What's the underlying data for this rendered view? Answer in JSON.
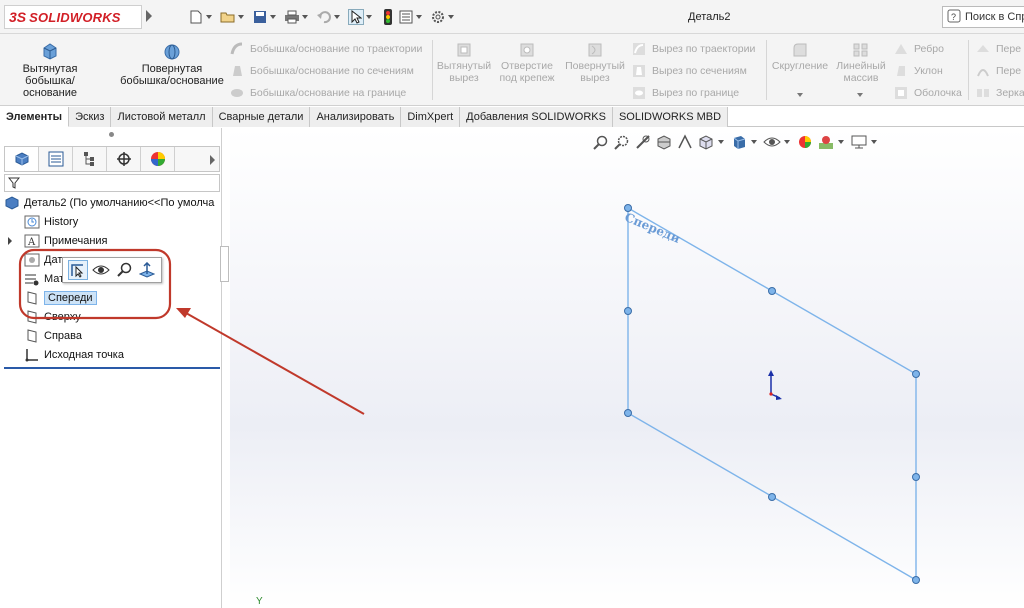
{
  "app": {
    "brand_prefix": "3S",
    "brand_name": "SOLIDWORKS",
    "document_title": "Деталь2",
    "search_placeholder": "Поиск в Спр"
  },
  "quick_access": {
    "icons": [
      "new-document-icon",
      "open-icon",
      "save-icon",
      "print-icon",
      "undo-icon",
      "select-icon",
      "rebuild-icon",
      "file-properties-icon",
      "options-icon"
    ]
  },
  "command_manager": {
    "extruded_boss": "Вытянутая\nбобышка/основание",
    "extruded_boss_l1": "Вытянутая",
    "extruded_boss_l2": "бобышка/основание",
    "revolved_boss_l1": "Повернутая",
    "revolved_boss_l2": "бобышка/основание",
    "swept_boss": "Бобышка/основание по траектории",
    "lofted_boss": "Бобышка/основание по сечениям",
    "boundary_boss": "Бобышка/основание на границе",
    "extruded_cut_l1": "Вытянутый",
    "extruded_cut_l2": "вырез",
    "hole_wizard_l1": "Отверстие",
    "hole_wizard_l2": "под крепеж",
    "revolved_cut_l1": "Повернутый",
    "revolved_cut_l2": "вырез",
    "swept_cut": "Вырез по траектории",
    "lofted_cut": "Вырез по сечениям",
    "boundary_cut": "Вырез по границе",
    "fillet": "Скругление",
    "linear_pattern_l1": "Линейный",
    "linear_pattern_l2": "массив",
    "rib": "Ребро",
    "draft": "Уклон",
    "shell": "Оболочка",
    "ref_geometry_1": "Пере",
    "ref_geometry_2": "Пере",
    "ref_geometry_3": "Зерка"
  },
  "tabs": [
    {
      "label": "Элементы",
      "active": true
    },
    {
      "label": "Эскиз",
      "active": false
    },
    {
      "label": "Листовой металл",
      "active": false
    },
    {
      "label": "Сварные детали",
      "active": false
    },
    {
      "label": "Анализировать",
      "active": false
    },
    {
      "label": "DimXpert",
      "active": false
    },
    {
      "label": "Добавления SOLIDWORKS",
      "active": false
    },
    {
      "label": "SOLIDWORKS MBD",
      "active": false
    }
  ],
  "panel_tabs": [
    "feature-manager-icon",
    "property-manager-icon",
    "configuration-manager-icon",
    "dimxpert-manager-icon",
    "display-manager-icon"
  ],
  "tree": {
    "root": "Деталь2  (По умолчанию<<По умолча",
    "items": [
      {
        "label": "History",
        "icon": "history-icon"
      },
      {
        "label": "Примечания",
        "icon": "annotations-icon"
      },
      {
        "label": "Датчики",
        "icon": "sensors-icon"
      },
      {
        "label": "Мат",
        "icon": "material-icon"
      },
      {
        "label": "Спереди",
        "icon": "plane-icon",
        "selected": true
      },
      {
        "label": "Сверху",
        "icon": "plane-icon"
      },
      {
        "label": "Справа",
        "icon": "plane-icon"
      },
      {
        "label": "Исходная точка",
        "icon": "origin-icon"
      }
    ]
  },
  "context_toolbar": [
    "sketch-icon",
    "show-hide-icon",
    "zoom-to-selection-icon",
    "normal-to-icon"
  ],
  "viewport": {
    "plane_label": "Спереди",
    "axis_label": "Y"
  },
  "colors": {
    "accent_blue": "#6a9bd6",
    "highlight_red": "#c0392b",
    "brand_red": "#d21f26"
  }
}
